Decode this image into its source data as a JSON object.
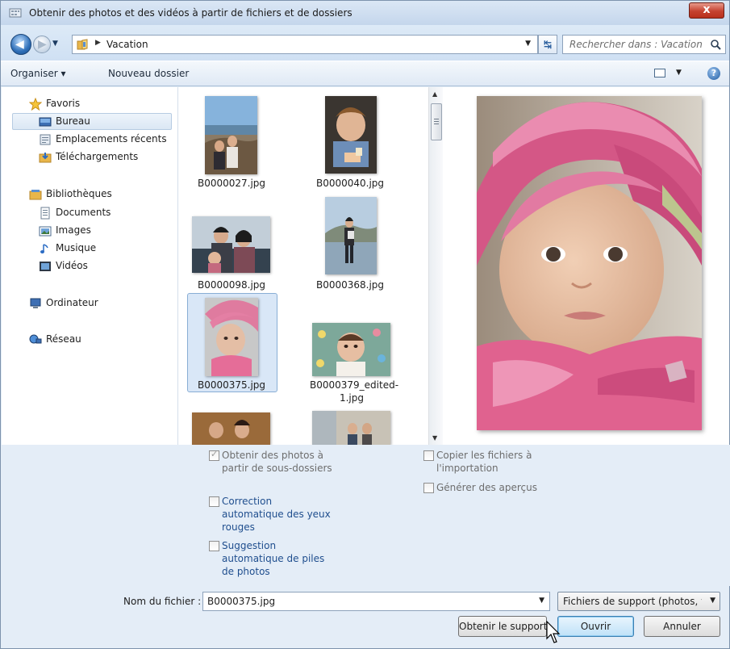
{
  "window": {
    "title": "Obtenir des photos et des vidéos à partir de fichiers et de dossiers",
    "close_label": "x"
  },
  "address_bar": {
    "path": [
      "Vacation"
    ],
    "search_placeholder": "Rechercher dans : Vacation"
  },
  "toolbar": {
    "organize_label": "Organiser ▾",
    "new_folder_label": "Nouveau dossier"
  },
  "nav": {
    "favorites": {
      "label": "Favoris",
      "items": [
        "Bureau",
        "Emplacements récents",
        "Téléchargements"
      ],
      "selected": "Bureau"
    },
    "libraries": {
      "label": "Bibliothèques",
      "items": [
        "Documents",
        "Images",
        "Musique",
        "Vidéos"
      ]
    },
    "computer": "Ordinateur",
    "network": "Réseau"
  },
  "files": [
    {
      "name": "B0000027.jpg",
      "selected": false
    },
    {
      "name": "B0000040.jpg",
      "selected": false
    },
    {
      "name": "B0000098.jpg",
      "selected": false
    },
    {
      "name": "B0000368.jpg",
      "selected": false
    },
    {
      "name": "B0000375.jpg",
      "selected": true
    },
    {
      "name_line1": "B0000379_edited-",
      "name_line2": "1.jpg",
      "selected": false
    }
  ],
  "options": {
    "subfolders": {
      "line1": "Obtenir des photos à",
      "line2": "partir de sous-dossiers",
      "checked": true
    },
    "copy_files": {
      "line1": "Copier les fichiers à",
      "line2": "l'importation",
      "checked": false
    },
    "previews": {
      "label": "Générer des aperçus",
      "checked": false
    },
    "red_eye": {
      "line1": "Correction",
      "line2": "automatique des yeux",
      "line3": "rouges",
      "checked": false
    },
    "stacks": {
      "line1": "Suggestion",
      "line2": "automatique de piles",
      "line3": "de photos",
      "checked": false
    }
  },
  "footer": {
    "filename_label": "Nom du fichier :",
    "filename_value": "B0000375.jpg",
    "filetype_value": "Fichiers de support (photos, vidéos)",
    "get_media_label": "Obtenir le support",
    "open_label": "Ouvrir",
    "cancel_label": "Annuler"
  },
  "colors": {
    "accent": "#3c7fb1",
    "pink_hat": "#e2769f",
    "window_bg": "#e4edf7"
  }
}
